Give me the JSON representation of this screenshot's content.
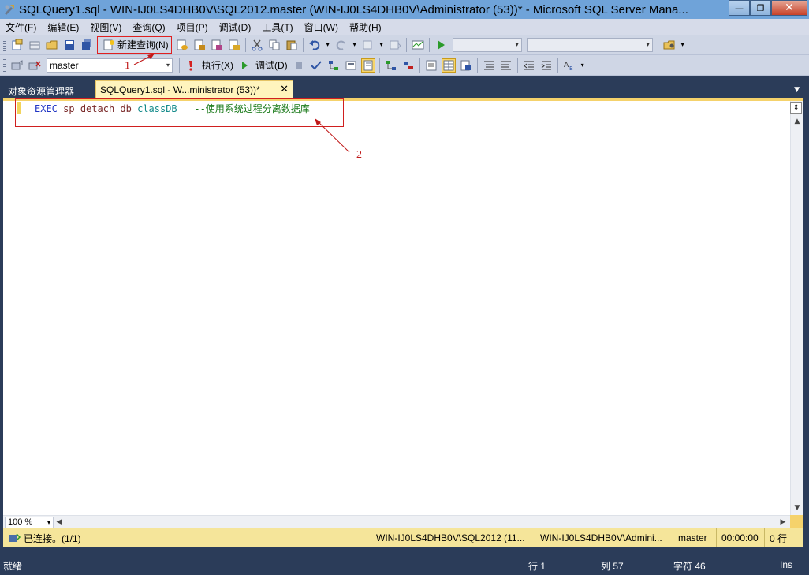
{
  "window": {
    "title": "SQLQuery1.sql - WIN-IJ0LS4DHB0V\\SQL2012.master (WIN-IJ0LS4DHB0V\\Administrator (53))* - Microsoft SQL Server Mana...",
    "minimize": "—",
    "restore": "❐",
    "close": "✕"
  },
  "menu": [
    "文件(F)",
    "编辑(E)",
    "视图(V)",
    "查询(Q)",
    "项目(P)",
    "调试(D)",
    "工具(T)",
    "窗口(W)",
    "帮助(H)"
  ],
  "toolbar1": {
    "new_query": "新建查询(N)",
    "db_combo_arrow": "▾"
  },
  "toolbar2": {
    "database": "master",
    "execute": "执行(X)",
    "debug": "调试(D)"
  },
  "tabs": {
    "object_explorer": "对象资源管理器",
    "active_tab": "SQLQuery1.sql - W...ministrator (53))*",
    "tab_close": "✕",
    "tab_menu": "▼"
  },
  "editor": {
    "keyword": "EXEC",
    "proc": "sp_detach_db",
    "db": "classDB",
    "comment": "--使用系统过程分离数据库"
  },
  "annotations": {
    "label1": "1",
    "label2": "2"
  },
  "zoom": "100 %",
  "query_status": {
    "connected": "已连接。(1/1)",
    "server": "WIN-IJ0LS4DHB0V\\SQL2012 (11...",
    "user": "WIN-IJ0LS4DHB0V\\Admini...",
    "database": "master",
    "elapsed": "00:00:00",
    "rows": "0 行"
  },
  "status": {
    "ready": "就绪",
    "line": "行 1",
    "col": "列 57",
    "ch": "字符 46",
    "mode": "Ins"
  }
}
